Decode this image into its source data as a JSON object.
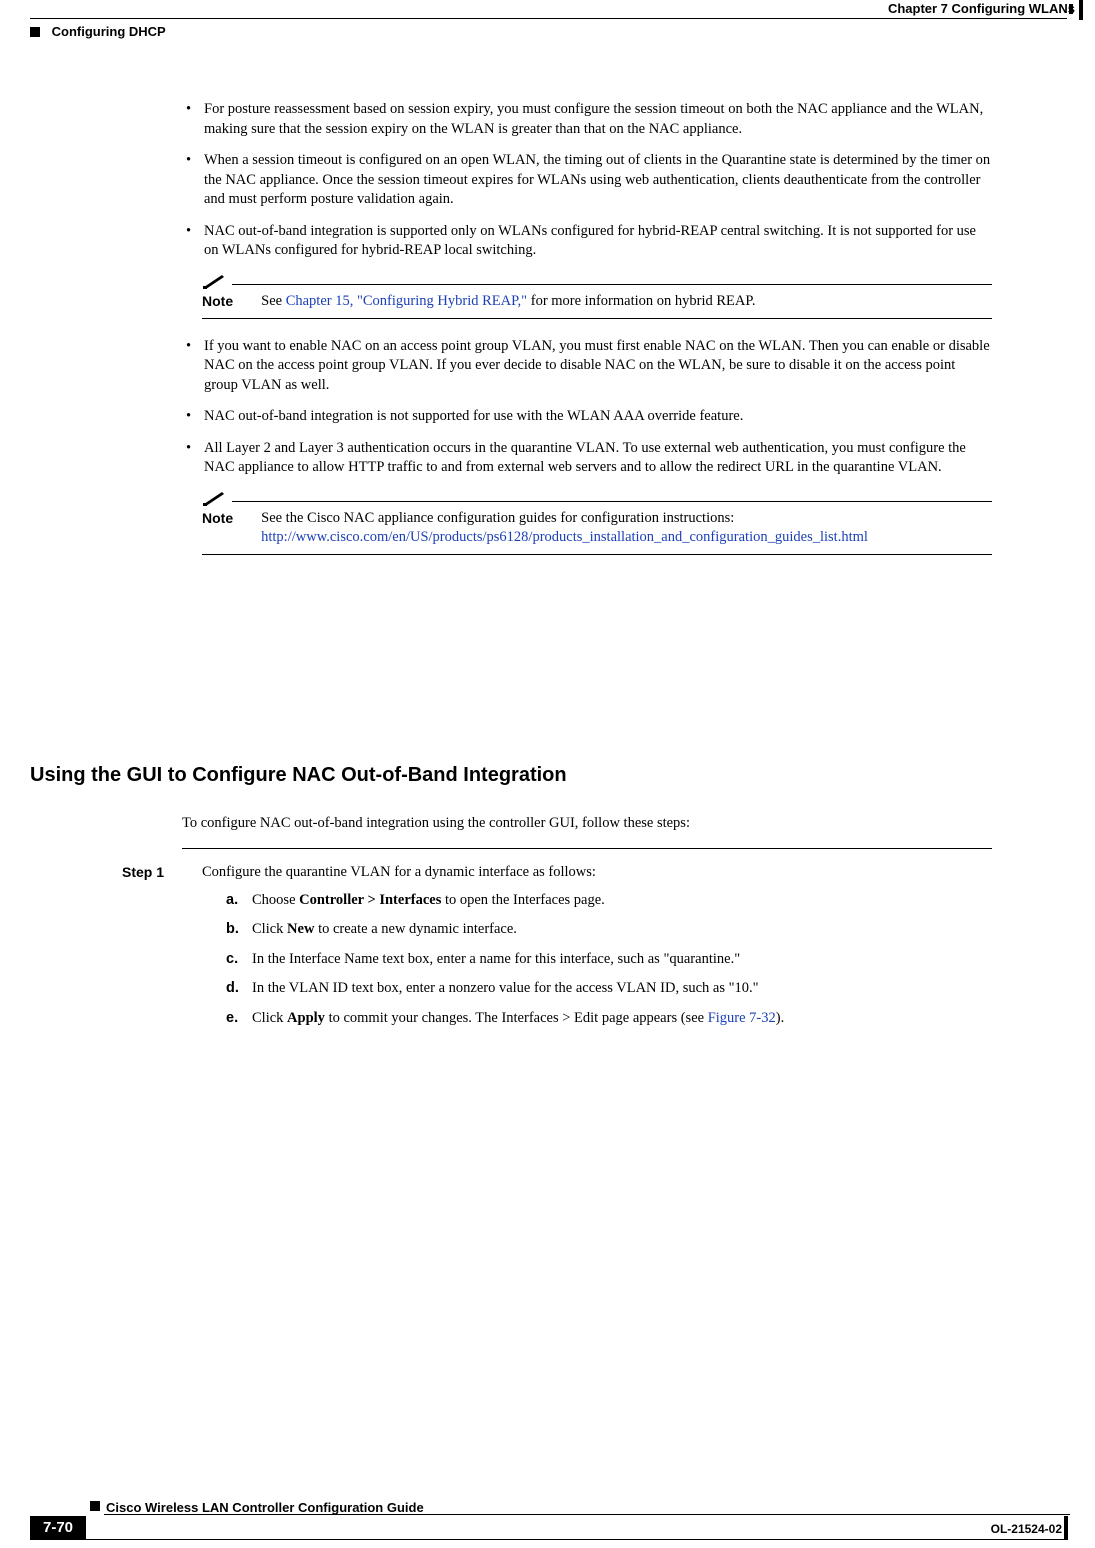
{
  "header": {
    "chapter": "Chapter 7      Configuring WLANs",
    "section": "Configuring DHCP"
  },
  "bullets": [
    "For posture reassessment based on session expiry, you must configure the session timeout on both the NAC appliance and the WLAN, making sure that the session expiry on the WLAN is greater than that on the NAC appliance.",
    "When a session timeout is configured on an open WLAN, the timing out of clients in the Quarantine state is determined by the timer on the NAC appliance. Once the session timeout expires for WLANs using web authentication, clients deauthenticate from the controller and must perform posture validation again.",
    "NAC out-of-band integration is supported only on WLANs configured for hybrid-REAP central switching. It is not supported for use on WLANs configured for hybrid-REAP local switching."
  ],
  "note1": {
    "label": "Note",
    "pre": "See ",
    "link": "Chapter 15, \"Configuring Hybrid REAP,\"",
    "post": " for more information on hybrid REAP."
  },
  "bullets2": [
    "If you want to enable NAC on an access point group VLAN, you must first enable NAC on the WLAN. Then you can enable or disable NAC on the access point group VLAN. If you ever decide to disable NAC on the WLAN, be sure to disable it on the access point group VLAN as well.",
    "NAC out-of-band integration is not supported for use with the WLAN AAA override feature.",
    "All Layer 2 and Layer 3 authentication occurs in the quarantine VLAN. To use external web authentication, you must configure the NAC appliance to allow HTTP traffic to and from external web servers and to allow the redirect URL in the quarantine VLAN."
  ],
  "note2": {
    "label": "Note",
    "line1": "See the Cisco NAC appliance configuration guides for configuration instructions: ",
    "link": "http://www.cisco.com/en/US/products/ps6128/products_installation_and_configuration_guides_list.html"
  },
  "subheading": "Using the GUI to Configure NAC Out-of-Band Integration",
  "intro": "To configure NAC out-of-band integration using the controller GUI, follow these steps:",
  "step1": {
    "label": "Step 1",
    "text": "Configure the quarantine VLAN for a dynamic interface as follows:",
    "subs": {
      "a": {
        "m": "a.",
        "pre": "Choose ",
        "bold": "Controller > Interfaces",
        "post": " to open the Interfaces page."
      },
      "b": {
        "m": "b.",
        "pre": "Click ",
        "bold": "New",
        "post": " to create a new dynamic interface."
      },
      "c": {
        "m": "c.",
        "text": "In the Interface Name text box, enter a name for this interface, such as \"quarantine.\""
      },
      "d": {
        "m": "d.",
        "text": "In the VLAN ID text box, enter a nonzero value for the access VLAN ID, such as \"10.\""
      },
      "e": {
        "m": "e.",
        "pre": "Click ",
        "bold": "Apply",
        "mid": " to commit your changes. The Interfaces > Edit page appears (see ",
        "link": "Figure 7-32",
        "post": ")."
      }
    }
  },
  "footer": {
    "title": "Cisco Wireless LAN Controller Configuration Guide",
    "page": "7-70",
    "doc": "OL-21524-02"
  }
}
